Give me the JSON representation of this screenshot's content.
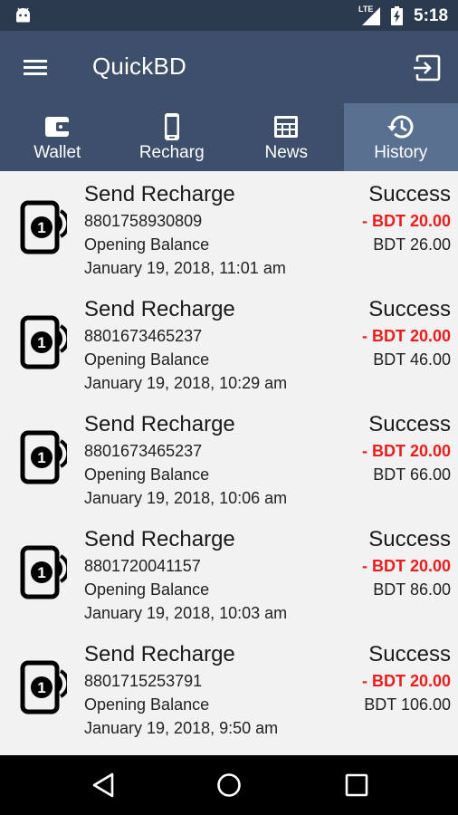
{
  "status_bar": {
    "network": "LTE",
    "time": "5:18"
  },
  "app_bar": {
    "title": "QuickBD",
    "menu_icon": "menu-icon",
    "logout_icon": "logout-icon"
  },
  "tabs": [
    {
      "label": "Wallet",
      "icon": "wallet-icon",
      "active": false
    },
    {
      "label": "Recharg",
      "icon": "phone-icon",
      "active": false
    },
    {
      "label": "News",
      "icon": "news-icon",
      "active": false
    },
    {
      "label": "History",
      "icon": "history-icon",
      "active": true
    }
  ],
  "transactions": [
    {
      "type": "Send Recharge",
      "number": "8801758930809",
      "balance_label": "Opening Balance",
      "date": "January 19, 2018, 11:01 am",
      "status": "Success",
      "amount": "- BDT 20.00",
      "balance": "BDT 26.00"
    },
    {
      "type": "Send Recharge",
      "number": "8801673465237",
      "balance_label": "Opening Balance",
      "date": "January 19, 2018, 10:29 am",
      "status": "Success",
      "amount": "- BDT 20.00",
      "balance": "BDT 46.00"
    },
    {
      "type": "Send Recharge",
      "number": "8801673465237",
      "balance_label": "Opening Balance",
      "date": "January 19, 2018, 10:06 am",
      "status": "Success",
      "amount": "- BDT 20.00",
      "balance": "BDT 66.00"
    },
    {
      "type": "Send Recharge",
      "number": "8801720041157",
      "balance_label": "Opening Balance",
      "date": "January 19, 2018, 10:03 am",
      "status": "Success",
      "amount": "- BDT 20.00",
      "balance": "BDT 86.00"
    },
    {
      "type": "Send Recharge",
      "number": "8801715253791",
      "balance_label": "Opening Balance",
      "date": "January 19, 2018, 9:50 am",
      "status": "Success",
      "amount": "- BDT 20.00",
      "balance": "BDT 106.00"
    }
  ],
  "colors": {
    "app_bar": "#3d4f6b",
    "status_bar": "#2c3a4f",
    "active_tab": "#5a7090",
    "amount_negative": "#ee1c1c",
    "list_background": "#f2f2f2"
  }
}
